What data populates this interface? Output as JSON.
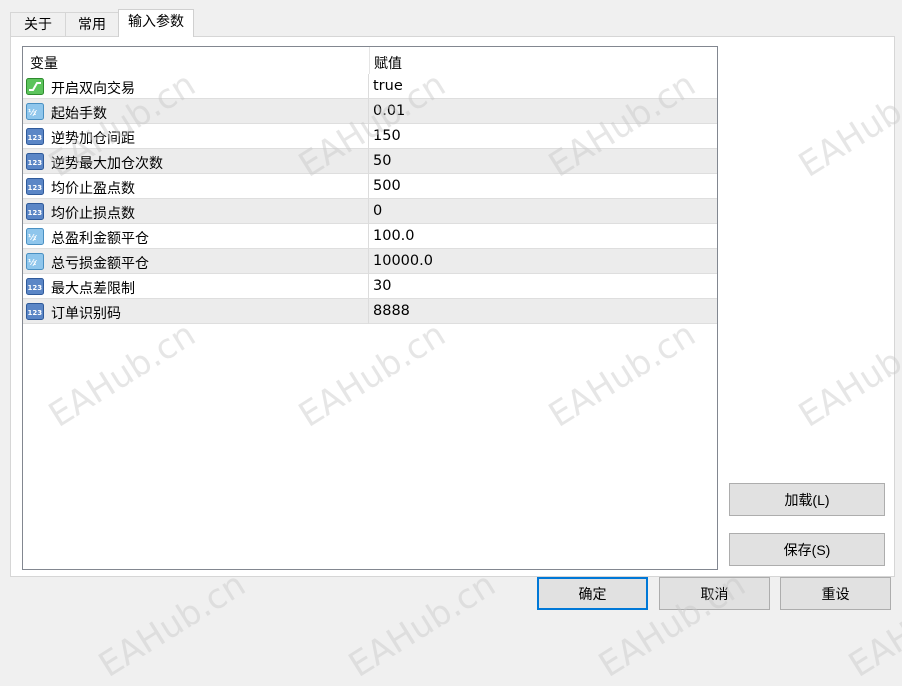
{
  "tabs": [
    {
      "label": "关于"
    },
    {
      "label": "常用"
    },
    {
      "label": "输入参数"
    }
  ],
  "table": {
    "headers": [
      "变量",
      "赋值"
    ],
    "rows": [
      {
        "icon": "bool-icon",
        "name": "开启双向交易",
        "value": "true"
      },
      {
        "icon": "double-icon",
        "name": "起始手数",
        "value": "0.01"
      },
      {
        "icon": "int-icon",
        "name": "逆势加仓间距",
        "value": "150"
      },
      {
        "icon": "int-icon",
        "name": "逆势最大加仓次数",
        "value": "50"
      },
      {
        "icon": "int-icon",
        "name": "均价止盈点数",
        "value": "500"
      },
      {
        "icon": "int-icon",
        "name": "均价止损点数",
        "value": "0"
      },
      {
        "icon": "double-icon",
        "name": "总盈利金额平仓",
        "value": "100.0"
      },
      {
        "icon": "double-icon",
        "name": "总亏损金额平仓",
        "value": "10000.0"
      },
      {
        "icon": "int-icon",
        "name": "最大点差限制",
        "value": "30"
      },
      {
        "icon": "int-icon",
        "name": "订单识别码",
        "value": "8888"
      }
    ]
  },
  "side_buttons": {
    "load": "加载(L)",
    "save": "保存(S)"
  },
  "footer_buttons": {
    "ok": "确定",
    "cancel": "取消",
    "reset": "重设"
  },
  "watermark": "EAHub.cn",
  "colors": {
    "accent": "#0078d7",
    "row_alt": "#ececec"
  }
}
